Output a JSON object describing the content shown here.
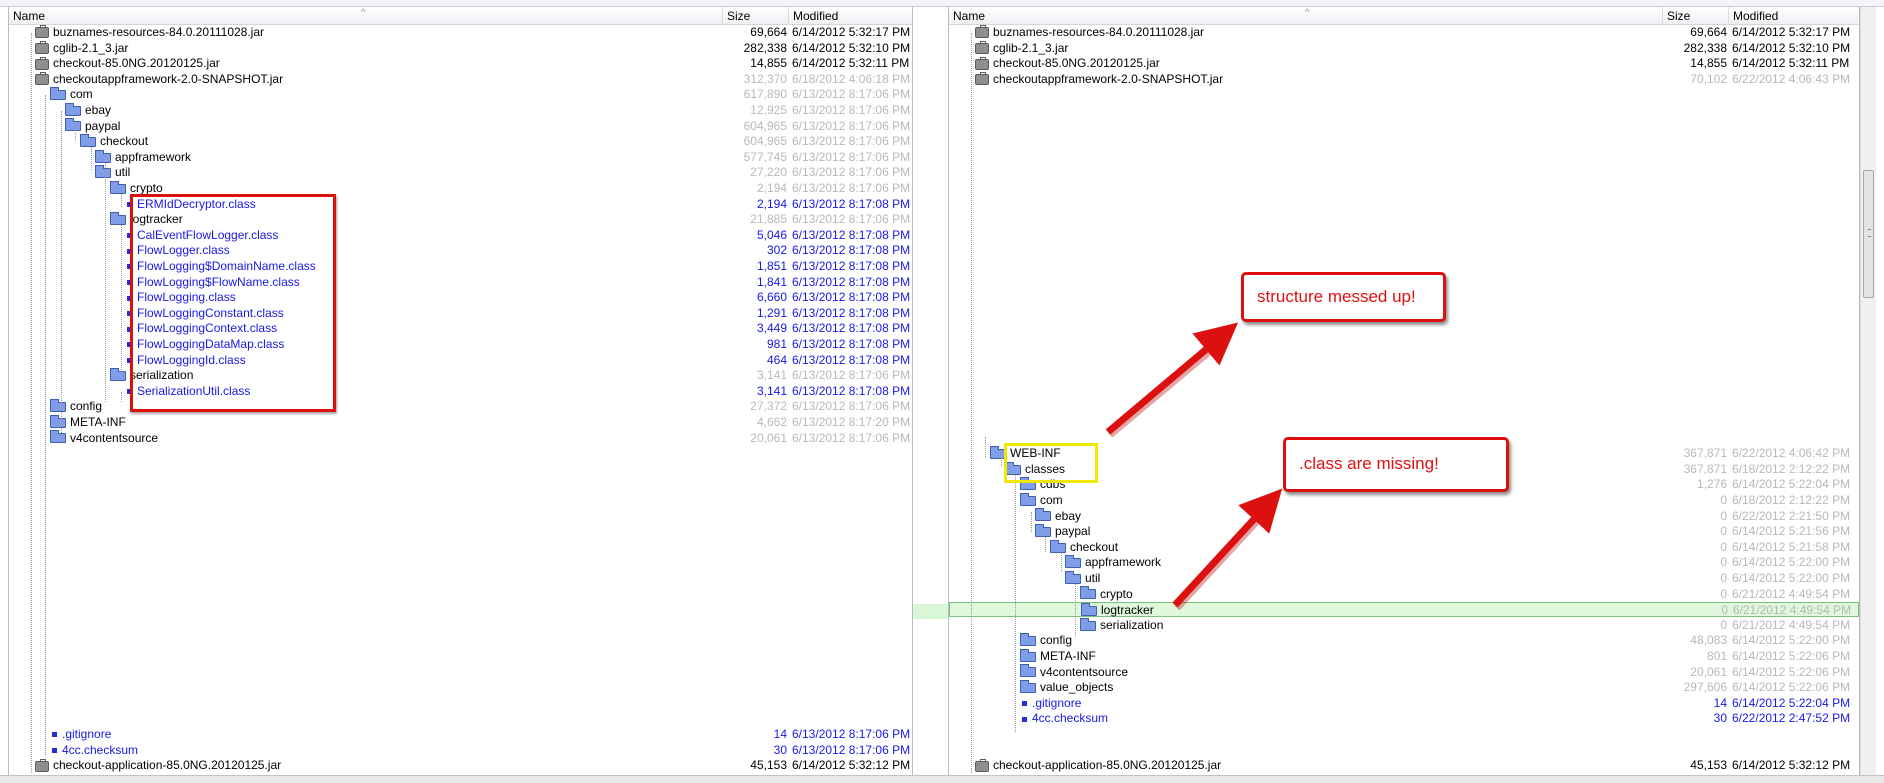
{
  "columns": {
    "name": "Name",
    "size": "Size",
    "modified": "Modified"
  },
  "left": {
    "rows": [
      {
        "name": "buznames-resources-84.0.20111028.jar",
        "icon": "jar-icon",
        "size": "69,664",
        "modified": "6/14/2012 5:32:17 PM",
        "indent": 0,
        "style": "normal"
      },
      {
        "name": "cglib-2.1_3.jar",
        "icon": "jar-icon",
        "size": "282,338",
        "modified": "6/14/2012 5:32:10 PM",
        "indent": 0,
        "style": "normal"
      },
      {
        "name": "checkout-85.0NG.20120125.jar",
        "icon": "jar-icon",
        "size": "14,855",
        "modified": "6/14/2012 5:32:11 PM",
        "indent": 0,
        "style": "normal"
      },
      {
        "name": "checkoutappframework-2.0-SNAPSHOT.jar",
        "icon": "jar-icon",
        "size": "312,370",
        "modified": "6/18/2012 4:06:18 PM",
        "indent": 0,
        "style": "dim"
      },
      {
        "name": "com",
        "icon": "folder-icon",
        "size": "617,890",
        "modified": "6/13/2012 8:17:06 PM",
        "indent": 1,
        "style": "dim"
      },
      {
        "name": "ebay",
        "icon": "folder-icon",
        "size": "12,925",
        "modified": "6/13/2012 8:17:06 PM",
        "indent": 2,
        "style": "dim"
      },
      {
        "name": "paypal",
        "icon": "folder-icon",
        "size": "604,965",
        "modified": "6/13/2012 8:17:06 PM",
        "indent": 2,
        "style": "dim"
      },
      {
        "name": "checkout",
        "icon": "folder-icon",
        "size": "604,965",
        "modified": "6/13/2012 8:17:06 PM",
        "indent": 3,
        "style": "dim"
      },
      {
        "name": "appframework",
        "icon": "folder-icon",
        "size": "577,745",
        "modified": "6/13/2012 8:17:06 PM",
        "indent": 4,
        "style": "dim"
      },
      {
        "name": "util",
        "icon": "folder-icon",
        "size": "27,220",
        "modified": "6/13/2012 8:17:06 PM",
        "indent": 4,
        "style": "dim"
      },
      {
        "name": "crypto",
        "icon": "folder-icon",
        "size": "2,194",
        "modified": "6/13/2012 8:17:06 PM",
        "indent": 5,
        "style": "dim"
      },
      {
        "name": "ERMIdDecryptor.class",
        "icon": "file-icon",
        "size": "2,194",
        "modified": "6/13/2012 8:17:08 PM",
        "indent": 6,
        "style": "blue"
      },
      {
        "name": "logtracker",
        "icon": "folder-icon",
        "size": "21,885",
        "modified": "6/13/2012 8:17:06 PM",
        "indent": 5,
        "style": "dim"
      },
      {
        "name": "CalEventFlowLogger.class",
        "icon": "file-icon",
        "size": "5,046",
        "modified": "6/13/2012 8:17:08 PM",
        "indent": 6,
        "style": "blue"
      },
      {
        "name": "FlowLogger.class",
        "icon": "file-icon",
        "size": "302",
        "modified": "6/13/2012 8:17:08 PM",
        "indent": 6,
        "style": "blue"
      },
      {
        "name": "FlowLogging$DomainName.class",
        "icon": "file-icon",
        "size": "1,851",
        "modified": "6/13/2012 8:17:08 PM",
        "indent": 6,
        "style": "blue"
      },
      {
        "name": "FlowLogging$FlowName.class",
        "icon": "file-icon",
        "size": "1,841",
        "modified": "6/13/2012 8:17:08 PM",
        "indent": 6,
        "style": "blue"
      },
      {
        "name": "FlowLogging.class",
        "icon": "file-icon",
        "size": "6,660",
        "modified": "6/13/2012 8:17:08 PM",
        "indent": 6,
        "style": "blue"
      },
      {
        "name": "FlowLoggingConstant.class",
        "icon": "file-icon",
        "size": "1,291",
        "modified": "6/13/2012 8:17:08 PM",
        "indent": 6,
        "style": "blue"
      },
      {
        "name": "FlowLoggingContext.class",
        "icon": "file-icon",
        "size": "3,449",
        "modified": "6/13/2012 8:17:08 PM",
        "indent": 6,
        "style": "blue"
      },
      {
        "name": "FlowLoggingDataMap.class",
        "icon": "file-icon",
        "size": "981",
        "modified": "6/13/2012 8:17:08 PM",
        "indent": 6,
        "style": "blue"
      },
      {
        "name": "FlowLoggingId.class",
        "icon": "file-icon",
        "size": "464",
        "modified": "6/13/2012 8:17:08 PM",
        "indent": 6,
        "style": "blue"
      },
      {
        "name": "serialization",
        "icon": "folder-icon",
        "size": "3,141",
        "modified": "6/13/2012 8:17:06 PM",
        "indent": 5,
        "style": "dim"
      },
      {
        "name": "SerializationUtil.class",
        "icon": "file-icon",
        "size": "3,141",
        "modified": "6/13/2012 8:17:08 PM",
        "indent": 6,
        "style": "blue"
      },
      {
        "name": "config",
        "icon": "folder-icon",
        "size": "27,372",
        "modified": "6/13/2012 8:17:06 PM",
        "indent": 1,
        "style": "dim"
      },
      {
        "name": "META-INF",
        "icon": "folder-icon",
        "size": "4,662",
        "modified": "6/13/2012 8:17:20 PM",
        "indent": 1,
        "style": "dim"
      },
      {
        "name": "v4contentsource",
        "icon": "folder-icon",
        "size": "20,061",
        "modified": "6/13/2012 8:17:06 PM",
        "indent": 1,
        "style": "dim"
      },
      {
        "name": "",
        "icon": "",
        "size": "",
        "modified": "",
        "indent": 0,
        "style": "normal"
      },
      {
        "name": "",
        "icon": "",
        "size": "",
        "modified": "",
        "indent": 0,
        "style": "normal"
      },
      {
        "name": "",
        "icon": "",
        "size": "",
        "modified": "",
        "indent": 0,
        "style": "normal"
      },
      {
        "name": "",
        "icon": "",
        "size": "",
        "modified": "",
        "indent": 0,
        "style": "normal"
      },
      {
        "name": "",
        "icon": "",
        "size": "",
        "modified": "",
        "indent": 0,
        "style": "normal"
      },
      {
        "name": "",
        "icon": "",
        "size": "",
        "modified": "",
        "indent": 0,
        "style": "normal"
      },
      {
        "name": "",
        "icon": "",
        "size": "",
        "modified": "",
        "indent": 0,
        "style": "normal"
      },
      {
        "name": "",
        "icon": "",
        "size": "",
        "modified": "",
        "indent": 0,
        "style": "normal"
      },
      {
        "name": "",
        "icon": "",
        "size": "",
        "modified": "",
        "indent": 0,
        "style": "normal"
      },
      {
        "name": "",
        "icon": "",
        "size": "",
        "modified": "",
        "indent": 0,
        "style": "normal"
      },
      {
        "name": "",
        "icon": "",
        "size": "",
        "modified": "",
        "indent": 0,
        "style": "normal"
      },
      {
        "name": "",
        "icon": "",
        "size": "",
        "modified": "",
        "indent": 0,
        "style": "normal"
      },
      {
        "name": "",
        "icon": "",
        "size": "",
        "modified": "",
        "indent": 0,
        "style": "normal"
      },
      {
        "name": "",
        "icon": "",
        "size": "",
        "modified": "",
        "indent": 0,
        "style": "normal"
      },
      {
        "name": "",
        "icon": "",
        "size": "",
        "modified": "",
        "indent": 0,
        "style": "normal"
      },
      {
        "name": "",
        "icon": "",
        "size": "",
        "modified": "",
        "indent": 0,
        "style": "normal"
      },
      {
        "name": "",
        "icon": "",
        "size": "",
        "modified": "",
        "indent": 0,
        "style": "normal"
      },
      {
        "name": "",
        "icon": "",
        "size": "",
        "modified": "",
        "indent": 0,
        "style": "normal"
      },
      {
        "name": ".gitignore",
        "icon": "file-icon",
        "size": "14",
        "modified": "6/13/2012 8:17:06 PM",
        "indent": 1,
        "style": "blue"
      },
      {
        "name": "4cc.checksum",
        "icon": "file-icon",
        "size": "30",
        "modified": "6/13/2012 8:17:06 PM",
        "indent": 1,
        "style": "blue"
      },
      {
        "name": "checkout-application-85.0NG.20120125.jar",
        "icon": "jar-icon",
        "size": "45,153",
        "modified": "6/14/2012 5:32:12 PM",
        "indent": 0,
        "style": "normal"
      }
    ]
  },
  "right": {
    "rows": [
      {
        "name": "buznames-resources-84.0.20111028.jar",
        "icon": "jar-icon",
        "size": "69,664",
        "modified": "6/14/2012 5:32:17 PM",
        "indent": 0,
        "style": "normal"
      },
      {
        "name": "cglib-2.1_3.jar",
        "icon": "jar-icon",
        "size": "282,338",
        "modified": "6/14/2012 5:32:10 PM",
        "indent": 0,
        "style": "normal"
      },
      {
        "name": "checkout-85.0NG.20120125.jar",
        "icon": "jar-icon",
        "size": "14,855",
        "modified": "6/14/2012 5:32:11 PM",
        "indent": 0,
        "style": "normal"
      },
      {
        "name": "checkoutappframework-2.0-SNAPSHOT.jar",
        "icon": "jar-icon",
        "size": "70,102",
        "modified": "6/22/2012 4:06:43 PM",
        "indent": 0,
        "style": "sizedim"
      },
      {
        "name": "",
        "icon": "",
        "size": "",
        "modified": "",
        "indent": 0,
        "style": "normal"
      },
      {
        "name": "",
        "icon": "",
        "size": "",
        "modified": "",
        "indent": 0,
        "style": "normal"
      },
      {
        "name": "",
        "icon": "",
        "size": "",
        "modified": "",
        "indent": 0,
        "style": "normal"
      },
      {
        "name": "",
        "icon": "",
        "size": "",
        "modified": "",
        "indent": 0,
        "style": "normal"
      },
      {
        "name": "",
        "icon": "",
        "size": "",
        "modified": "",
        "indent": 0,
        "style": "normal"
      },
      {
        "name": "",
        "icon": "",
        "size": "",
        "modified": "",
        "indent": 0,
        "style": "normal"
      },
      {
        "name": "",
        "icon": "",
        "size": "",
        "modified": "",
        "indent": 0,
        "style": "normal"
      },
      {
        "name": "",
        "icon": "",
        "size": "",
        "modified": "",
        "indent": 0,
        "style": "normal"
      },
      {
        "name": "",
        "icon": "",
        "size": "",
        "modified": "",
        "indent": 0,
        "style": "normal"
      },
      {
        "name": "",
        "icon": "",
        "size": "",
        "modified": "",
        "indent": 0,
        "style": "normal"
      },
      {
        "name": "",
        "icon": "",
        "size": "",
        "modified": "",
        "indent": 0,
        "style": "normal"
      },
      {
        "name": "",
        "icon": "",
        "size": "",
        "modified": "",
        "indent": 0,
        "style": "normal"
      },
      {
        "name": "",
        "icon": "",
        "size": "",
        "modified": "",
        "indent": 0,
        "style": "normal"
      },
      {
        "name": "",
        "icon": "",
        "size": "",
        "modified": "",
        "indent": 0,
        "style": "normal"
      },
      {
        "name": "",
        "icon": "",
        "size": "",
        "modified": "",
        "indent": 0,
        "style": "normal"
      },
      {
        "name": "",
        "icon": "",
        "size": "",
        "modified": "",
        "indent": 0,
        "style": "normal"
      },
      {
        "name": "",
        "icon": "",
        "size": "",
        "modified": "",
        "indent": 0,
        "style": "normal"
      },
      {
        "name": "",
        "icon": "",
        "size": "",
        "modified": "",
        "indent": 0,
        "style": "normal"
      },
      {
        "name": "",
        "icon": "",
        "size": "",
        "modified": "",
        "indent": 0,
        "style": "normal"
      },
      {
        "name": "",
        "icon": "",
        "size": "",
        "modified": "",
        "indent": 0,
        "style": "normal"
      },
      {
        "name": "",
        "icon": "",
        "size": "",
        "modified": "",
        "indent": 0,
        "style": "normal"
      },
      {
        "name": "",
        "icon": "",
        "size": "",
        "modified": "",
        "indent": 0,
        "style": "normal"
      },
      {
        "name": "",
        "icon": "",
        "size": "",
        "modified": "",
        "indent": 0,
        "style": "normal"
      },
      {
        "name": "WEB-INF",
        "icon": "folder-icon",
        "size": "367,871",
        "modified": "6/22/2012 4:06:42 PM",
        "indent": 1,
        "style": "dim"
      },
      {
        "name": "classes",
        "icon": "folder-icon",
        "size": "367,871",
        "modified": "6/18/2012 2:12:22 PM",
        "indent": 2,
        "style": "dim"
      },
      {
        "name": "cdbs",
        "icon": "folder-icon",
        "size": "1,276",
        "modified": "6/14/2012 5:22:04 PM",
        "indent": 3,
        "style": "dim"
      },
      {
        "name": "com",
        "icon": "folder-icon",
        "size": "0",
        "modified": "6/18/2012 2:12:22 PM",
        "indent": 3,
        "style": "dim"
      },
      {
        "name": "ebay",
        "icon": "folder-icon",
        "size": "0",
        "modified": "6/22/2012 2:21:50 PM",
        "indent": 4,
        "style": "dim"
      },
      {
        "name": "paypal",
        "icon": "folder-icon",
        "size": "0",
        "modified": "6/14/2012 5:21:56 PM",
        "indent": 4,
        "style": "dim"
      },
      {
        "name": "checkout",
        "icon": "folder-icon",
        "size": "0",
        "modified": "6/14/2012 5:21:58 PM",
        "indent": 5,
        "style": "dim"
      },
      {
        "name": "appframework",
        "icon": "folder-icon",
        "size": "0",
        "modified": "6/14/2012 5:22:00 PM",
        "indent": 6,
        "style": "dim"
      },
      {
        "name": "util",
        "icon": "folder-icon",
        "size": "0",
        "modified": "6/14/2012 5:22:00 PM",
        "indent": 6,
        "style": "dim"
      },
      {
        "name": "crypto",
        "icon": "folder-icon",
        "size": "0",
        "modified": "6/21/2012 4:49:54 PM",
        "indent": 7,
        "style": "dim"
      },
      {
        "name": "logtracker",
        "icon": "folder-icon",
        "size": "0",
        "modified": "6/21/2012 4:49:54 PM",
        "indent": 7,
        "style": "dim",
        "selected": true
      },
      {
        "name": "serialization",
        "icon": "folder-icon",
        "size": "0",
        "modified": "6/21/2012 4:49:54 PM",
        "indent": 7,
        "style": "dim"
      },
      {
        "name": "config",
        "icon": "folder-icon",
        "size": "48,083",
        "modified": "6/14/2012 5:22:00 PM",
        "indent": 3,
        "style": "dim"
      },
      {
        "name": "META-INF",
        "icon": "folder-icon",
        "size": "801",
        "modified": "6/14/2012 5:22:06 PM",
        "indent": 3,
        "style": "dim"
      },
      {
        "name": "v4contentsource",
        "icon": "folder-icon",
        "size": "20,061",
        "modified": "6/14/2012 5:22:06 PM",
        "indent": 3,
        "style": "dim"
      },
      {
        "name": "value_objects",
        "icon": "folder-icon",
        "size": "297,606",
        "modified": "6/14/2012 5:22:06 PM",
        "indent": 3,
        "style": "dim"
      },
      {
        "name": ".gitignore",
        "icon": "file-icon",
        "size": "14",
        "modified": "6/14/2012 5:22:04 PM",
        "indent": 3,
        "style": "blue"
      },
      {
        "name": "4cc.checksum",
        "icon": "file-icon",
        "size": "30",
        "modified": "6/22/2012 2:47:52 PM",
        "indent": 3,
        "style": "blue"
      },
      {
        "name": "",
        "icon": "",
        "size": "",
        "modified": "",
        "indent": 0,
        "style": "normal"
      },
      {
        "name": "",
        "icon": "",
        "size": "",
        "modified": "",
        "indent": 0,
        "style": "normal"
      },
      {
        "name": "checkout-application-85.0NG.20120125.jar",
        "icon": "jar-icon",
        "size": "45,153",
        "modified": "6/14/2012 5:32:12 PM",
        "indent": 0,
        "style": "normal"
      }
    ]
  },
  "annotations": {
    "structure": "structure messed up!",
    "missing": ".class are missing!"
  },
  "colors": {
    "accent_red": "#dd1010",
    "highlight_yellow": "#f0e800",
    "link_blue": "#1818e6",
    "selection_green": "#dff7da"
  }
}
